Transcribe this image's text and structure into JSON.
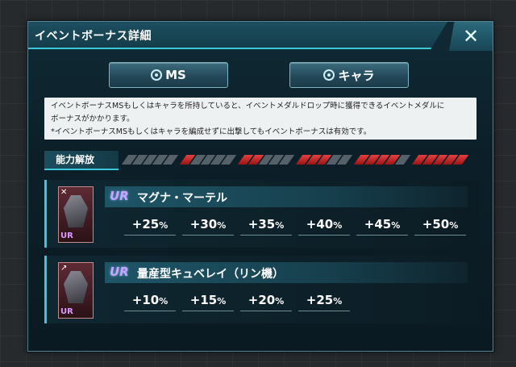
{
  "dialog": {
    "title": "イベントボーナス詳細",
    "close_label": "✕"
  },
  "tabs": [
    {
      "label": "MS"
    },
    {
      "label": "キャラ"
    }
  ],
  "description": {
    "line1": "イベントボーナスMSもしくはキャラを所持していると、イベントメダルドロップ時に獲得できるイベントメダルに",
    "line2": "ボーナスがかかります。",
    "line3": "*イベントボーナスMSもしくはキャラを編成せずに出撃してもイベントボーナスは有効です。"
  },
  "level_header": {
    "label": "能力解放",
    "levels_filled": [
      0,
      1,
      2,
      3,
      4,
      5
    ]
  },
  "units": [
    {
      "rarity": "UR",
      "name": "マグナ・マーテル",
      "bonuses": [
        "+25",
        "+30",
        "+35",
        "+40",
        "+45",
        "+50"
      ],
      "unit_suffix": "%"
    },
    {
      "rarity": "UR",
      "name": "量産型キュベレイ（リン機）",
      "bonuses": [
        "+10",
        "+15",
        "+20",
        "+25"
      ],
      "unit_suffix": "%"
    }
  ],
  "colors": {
    "accent": "#3cc8dc",
    "level_red": "#d42b2b",
    "background": "#0c1f28"
  }
}
